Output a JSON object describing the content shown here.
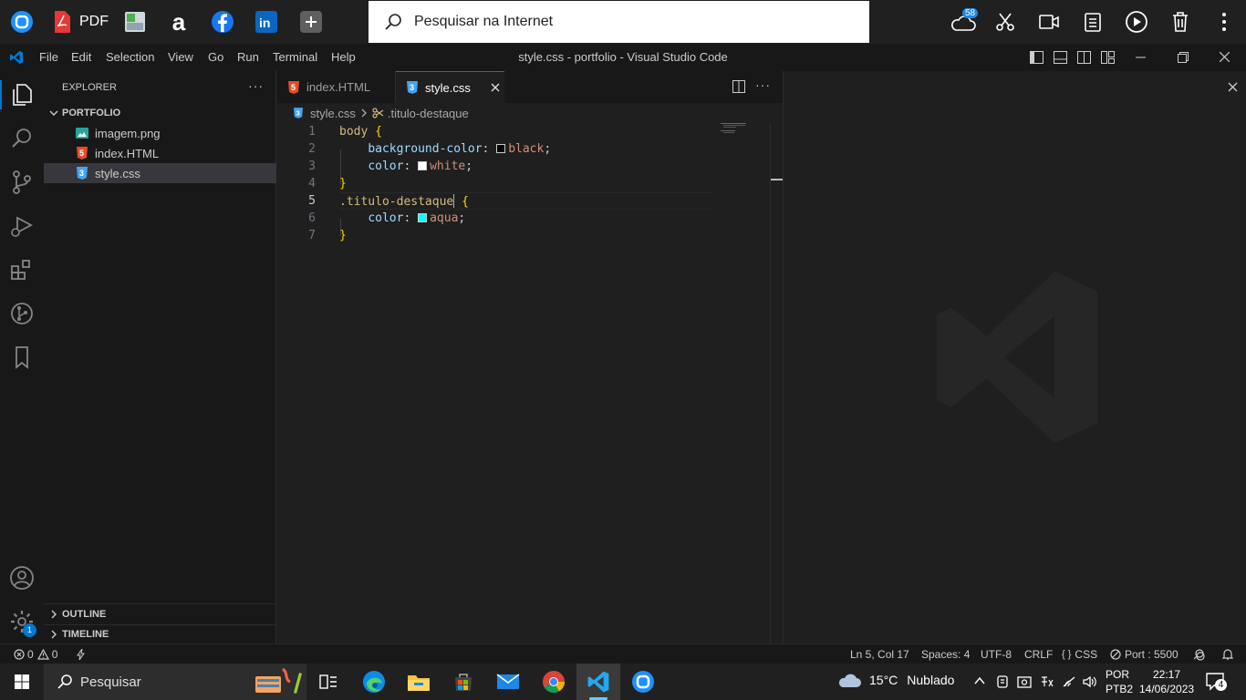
{
  "top_taskbar": {
    "pdf_label": "PDF",
    "search_placeholder": "Pesquisar na Internet",
    "cloud_badge": "58"
  },
  "window": {
    "title": "style.css - portfolio - Visual Studio Code",
    "menu": [
      "File",
      "Edit",
      "Selection",
      "View",
      "Go",
      "Run",
      "Terminal",
      "Help"
    ]
  },
  "sidebar": {
    "header": "EXPLORER",
    "folder": "PORTFOLIO",
    "files": [
      {
        "name": "imagem.png",
        "type": "image"
      },
      {
        "name": "index.HTML",
        "type": "html"
      },
      {
        "name": "style.css",
        "type": "css",
        "selected": true
      }
    ],
    "outline_label": "OUTLINE",
    "timeline_label": "TIMELINE",
    "settings_badge": "1"
  },
  "tabs": [
    {
      "label": "index.HTML",
      "active": false
    },
    {
      "label": "style.css",
      "active": true
    }
  ],
  "breadcrumb": {
    "file": "style.css",
    "symbol": ".titulo-destaque"
  },
  "editor": {
    "line_numbers": [
      "1",
      "2",
      "3",
      "4",
      "5",
      "6",
      "7"
    ],
    "current_line": "5",
    "lines": {
      "l1_selector": "body",
      "l1_brace": "{",
      "l2_prop": "background-color",
      "l2_value": "black",
      "l3_prop": "color",
      "l3_value": "white",
      "l4_brace": "}",
      "l5_selector": ".titulo-destaque",
      "l5_brace": "{",
      "l6_prop": "color",
      "l6_value": "aqua",
      "l7_brace": "}"
    },
    "swatch_colors": {
      "black": "#000000",
      "white": "#ffffff",
      "aqua": "#00ffff"
    }
  },
  "status_bar": {
    "errors": "0",
    "warnings": "0",
    "position": "Ln 5, Col 17",
    "spaces": "Spaces: 4",
    "encoding": "UTF-8",
    "eol": "CRLF",
    "language": "CSS",
    "port": "Port : 5500"
  },
  "win_taskbar": {
    "search_label": "Pesquisar",
    "weather_temp": "15°C",
    "weather_desc": "Nublado",
    "lang_1": "POR",
    "lang_2": "PTB2",
    "time": "22:17",
    "date": "14/06/2023",
    "notification_count": "4"
  },
  "colors": {
    "accent": "#0078d4",
    "html_icon": "#e44d26",
    "css_icon": "#42a5f5"
  }
}
